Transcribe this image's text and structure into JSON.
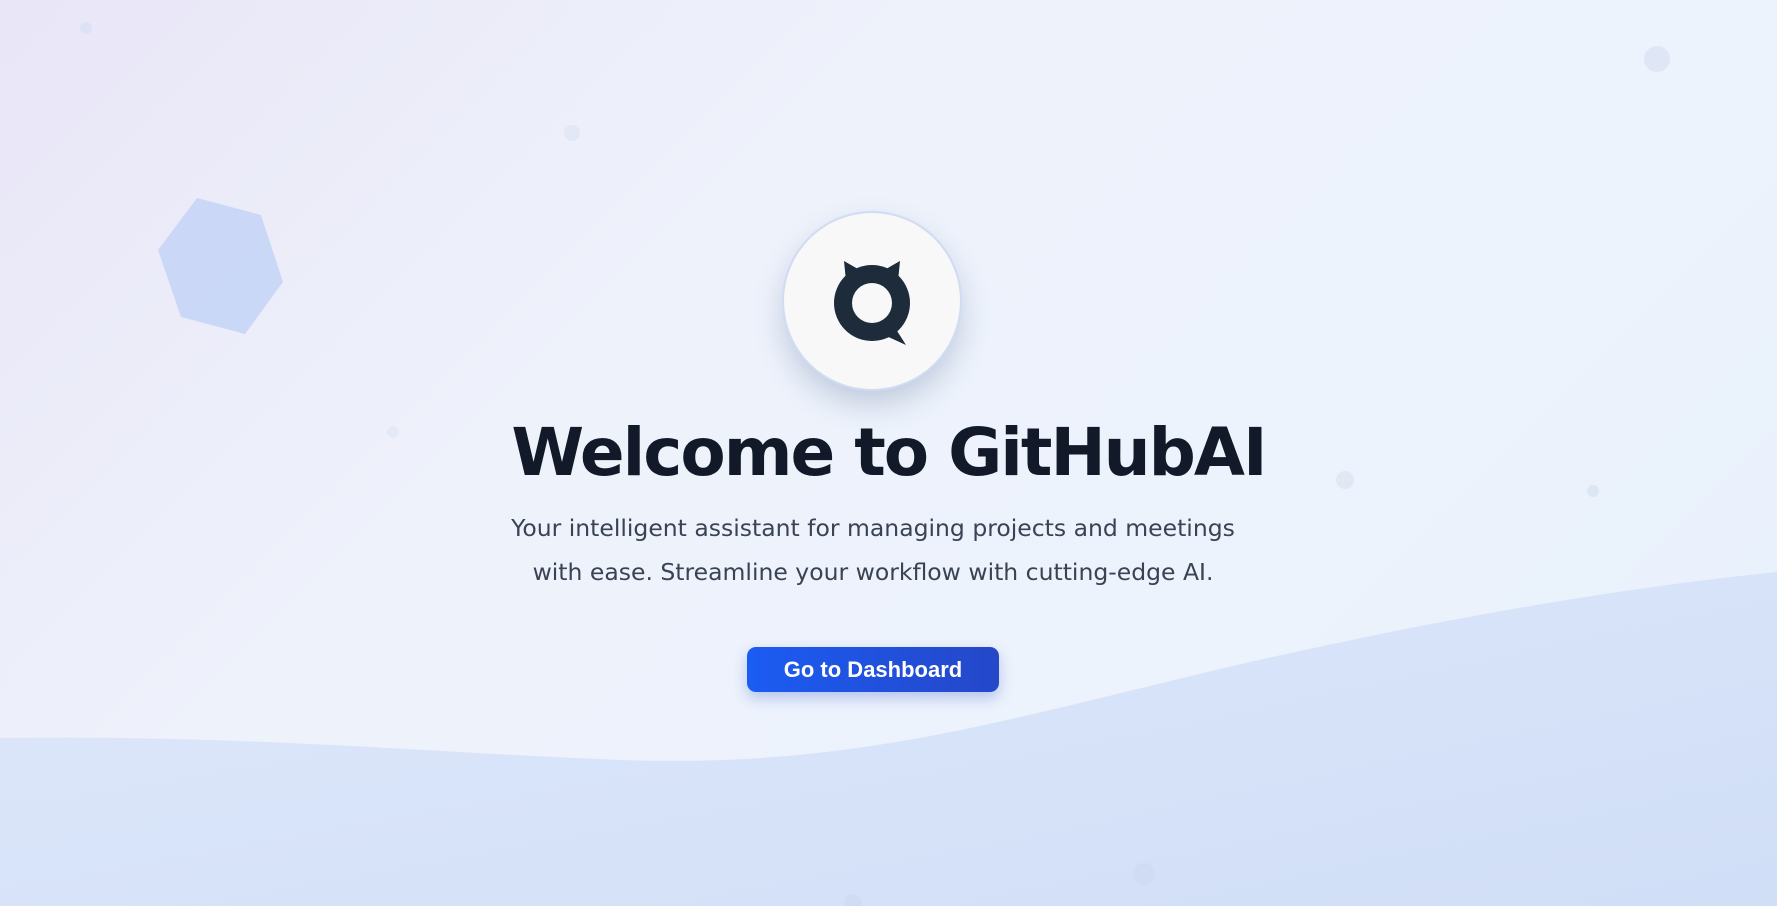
{
  "hero": {
    "logo_icon": "chat-bot-logo-icon",
    "title": "Welcome to GitHubAI",
    "subtitle_line1": "Your intelligent assistant for managing projects and meetings",
    "subtitle_line2": "with ease. Streamline your workflow with cutting-edge AI.",
    "cta_label": "Go to Dashboard"
  },
  "colors": {
    "accent": "#1b5cf3",
    "title": "#121a2a",
    "text": "#3a4354",
    "logo": "#1d2b3a",
    "wave": "#d2e0f8"
  }
}
